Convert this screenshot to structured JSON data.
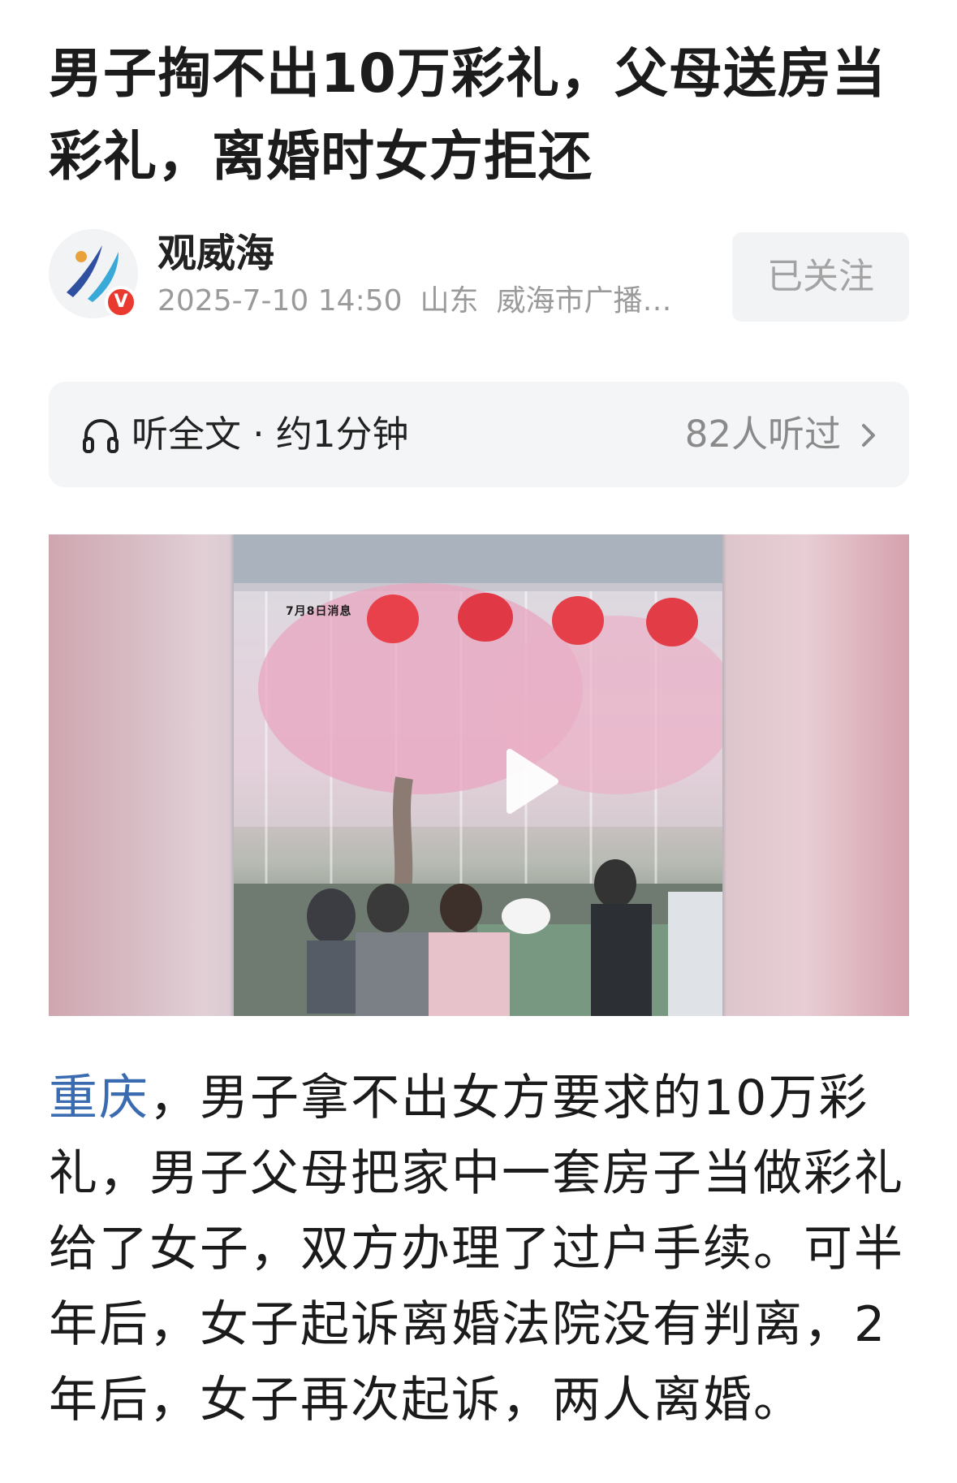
{
  "article": {
    "title": "男子掏不出10万彩礼，父母送房当彩礼，离婚时女方拒还",
    "author": {
      "name": "观威海",
      "verified_badge": "V",
      "avatar_icon": "brand-logo-icon"
    },
    "meta": {
      "datetime": "2025-7-10 14:50",
      "region": "山东",
      "source": "威海市广播…"
    },
    "follow_button": {
      "label": "已关注"
    },
    "listen": {
      "icon": "headphone-icon",
      "label": "听全文 · 约1分钟",
      "count": "82人听过",
      "chevron": "›"
    },
    "video": {
      "overlay_text": "7月8日消息",
      "play_icon": "play-icon"
    },
    "body": {
      "location": "重庆",
      "text": "，男子拿不出女方要求的10万彩礼，男子父母把家中一套房子当做彩礼给了女子，双方办理了过户手续。可半年后，女子起诉离婚法院没有判离，2年后，女子再次起诉，两人离婚。"
    }
  },
  "colors": {
    "link": "#3a6bb0",
    "badge": "#ea3a2f",
    "muted": "#9a9a9a",
    "panel": "#f4f5f7"
  }
}
